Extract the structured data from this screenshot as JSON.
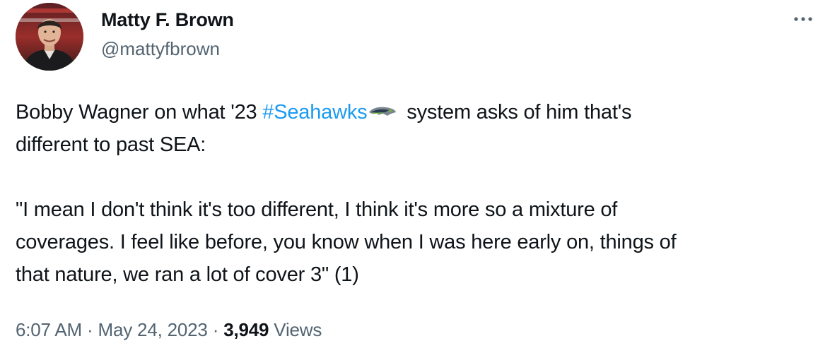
{
  "author": {
    "display_name": "Matty F. Brown",
    "handle": "@mattyfbrown"
  },
  "tweet": {
    "line1_prefix": "Bobby Wagner on what '23 ",
    "hashtag": "#Seahawks",
    "line1_suffix": " system asks of him that's",
    "line2": "different to past SEA:",
    "line3": "\"I mean I don't think it's too different, I think it's more so a mixture of",
    "line4": "coverages. I feel like before, you know when I was here early on, things of",
    "line5": "that nature, we ran a lot of cover 3\" (1)"
  },
  "meta": {
    "time": "6:07 AM",
    "separator1": " · ",
    "date": "May 24, 2023",
    "separator2": " · ",
    "views_count": "3,949",
    "views_label": " Views"
  },
  "icons": {
    "more": "more-options-icon",
    "hashflag": "seahawks-logo-icon"
  },
  "colors": {
    "text": "#0f1419",
    "secondary": "#536471",
    "link": "#1d9bf0",
    "background": "#ffffff"
  }
}
